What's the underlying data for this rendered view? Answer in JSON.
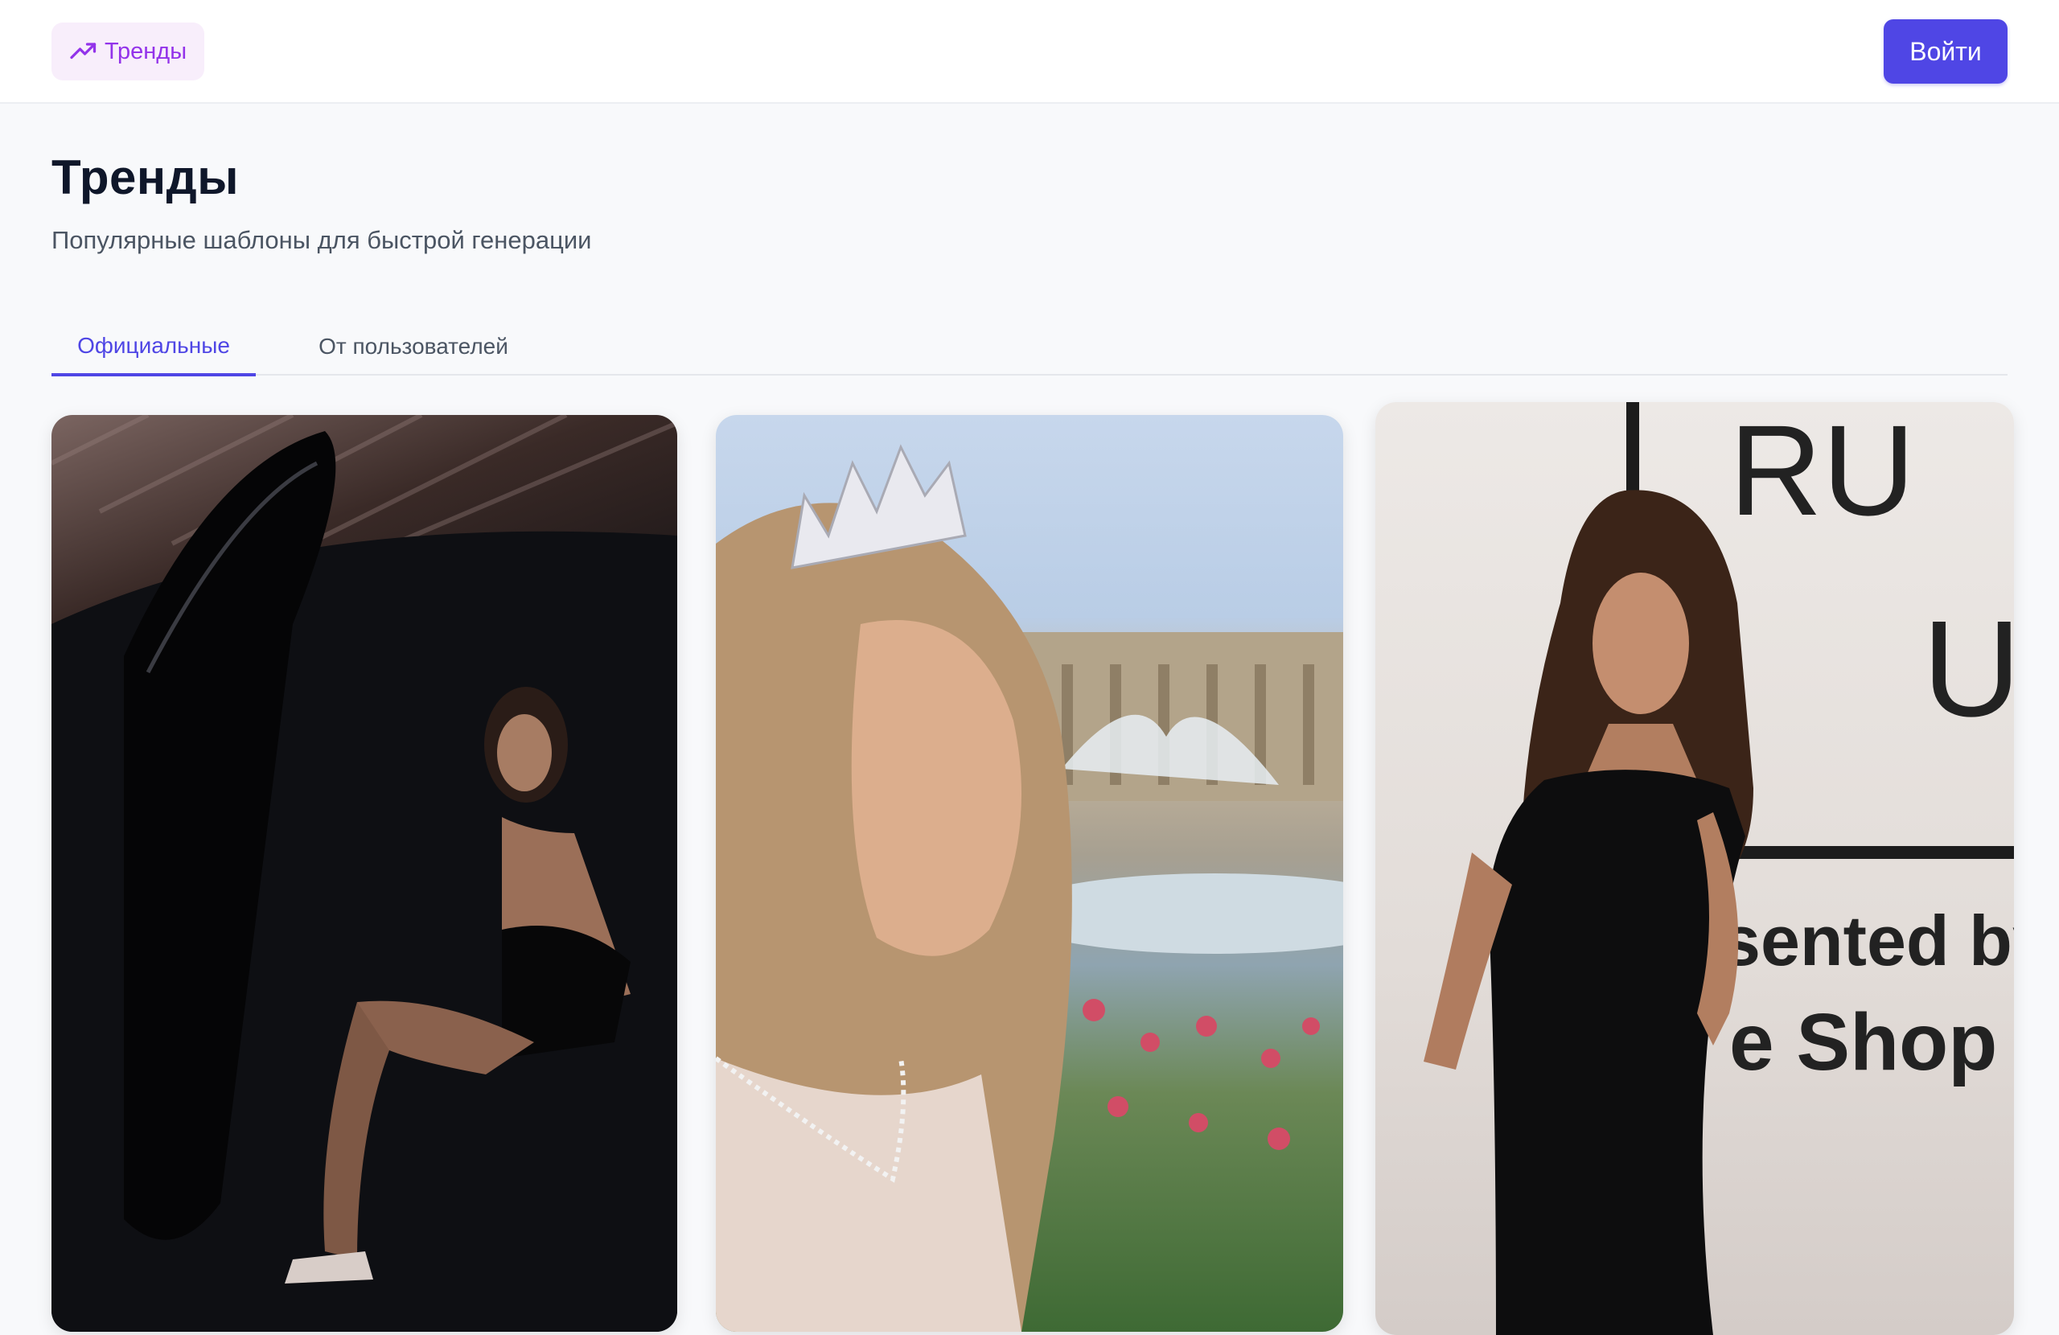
{
  "header": {
    "trends_chip_label": "Тренды",
    "trends_icon": "trending-up-icon",
    "login_label": "Войти"
  },
  "main": {
    "title": "Тренды",
    "subtitle": "Популярные шаблоны для быстрой генерации",
    "tabs": [
      {
        "label": "Официальные",
        "active": true
      },
      {
        "label": "От пользователей",
        "active": false
      }
    ]
  },
  "cards": [
    {
      "image": "woman-exiting-car-photo"
    },
    {
      "image": "woman-with-tiara-palace-photo"
    },
    {
      "image": "woman-black-dress-event-photo",
      "visible_text": [
        "RU",
        "U",
        "sented by",
        "e Shop"
      ]
    }
  ],
  "colors": {
    "accent": "#4f46e5",
    "chip_text": "#9333ea",
    "chip_bg": "#f8eefb",
    "page_bg": "#f8f9fb"
  }
}
